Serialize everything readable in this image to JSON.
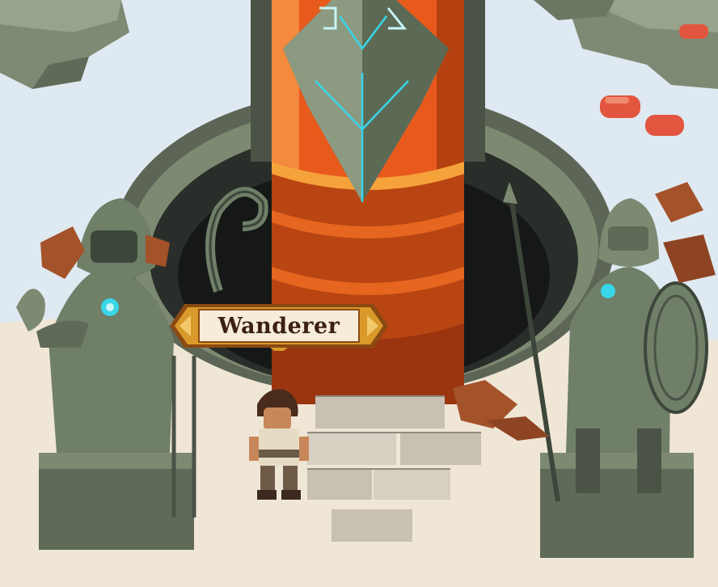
{
  "character": {
    "name": "Wanderer"
  },
  "colors": {
    "snow": "#dfe9f1",
    "sand": "#efe6d6",
    "pillar_orange": "#e85a1c",
    "pillar_dark": "#9a3510",
    "stone": "#6f7f68",
    "crystal_glow": "#38d6e8",
    "nameplate_gold": "#d99a2b",
    "nameplate_fill": "#f6ecd8"
  }
}
